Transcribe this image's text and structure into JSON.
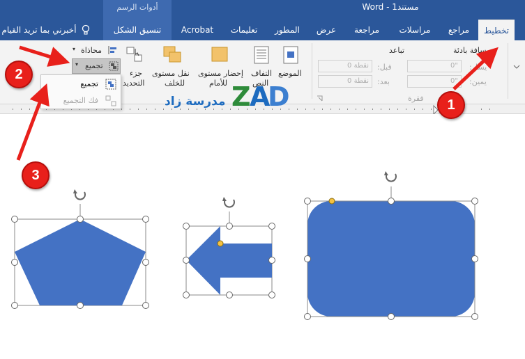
{
  "title_bar": {
    "contextual_group": "أدوات الرسم",
    "document_title": "مستند1  -  Word"
  },
  "tabs": [
    {
      "id": "tab-layout",
      "label": "تخطيط",
      "active": true
    },
    {
      "id": "tab-references",
      "label": "مراجع"
    },
    {
      "id": "tab-mailings",
      "label": "مراسلات"
    },
    {
      "id": "tab-review",
      "label": "مراجعة"
    },
    {
      "id": "tab-view",
      "label": "عرض"
    },
    {
      "id": "tab-developer",
      "label": "المطور"
    },
    {
      "id": "tab-help",
      "label": "تعليمات"
    },
    {
      "id": "tab-acrobat",
      "label": "Acrobat"
    },
    {
      "id": "tab-shape-format",
      "label": "تنسيق الشكل"
    },
    {
      "id": "tell-me",
      "label": "أخبرني بما تريد القيام"
    }
  ],
  "ribbon": {
    "indent_label": "مسافة بادئة",
    "spacing_label": "تباعد",
    "indent_left_label": "يسار:",
    "indent_right_label": "يمين:",
    "spacing_before_label": "قبل:",
    "spacing_after_label": "بعد:",
    "indent_left_value": "0\"",
    "indent_right_value": "0\"",
    "spacing_before_value": "0 نقطة",
    "spacing_after_value": "0 نقطة",
    "paragraph_group_label": "فقرة",
    "arrange": {
      "position": "الموضع",
      "wrap_text_line1": "التفاف",
      "wrap_text_line2": "النص",
      "bring_forward_line1": "إحضار مستوى",
      "bring_forward_line2": "للأمام",
      "send_backward_line1": "نقل مستوى",
      "send_backward_line2": "للخلف",
      "selection_pane_line1": "جزء",
      "selection_pane_line2": "التحديد",
      "align": "محاذاة",
      "group": "تجميع"
    }
  },
  "group_dropdown": {
    "items": [
      {
        "label": "تجميع",
        "enabled": true
      },
      {
        "label": "فك التجميع",
        "enabled": false
      }
    ]
  },
  "watermark": {
    "text": "مدرسة زاد"
  },
  "callouts": [
    "1",
    "2",
    "3"
  ],
  "colors": {
    "word_blue": "#2b579a",
    "shape_fill": "#4472c4",
    "badge_red": "#e8201b",
    "arrow_red": "#e8201b"
  }
}
